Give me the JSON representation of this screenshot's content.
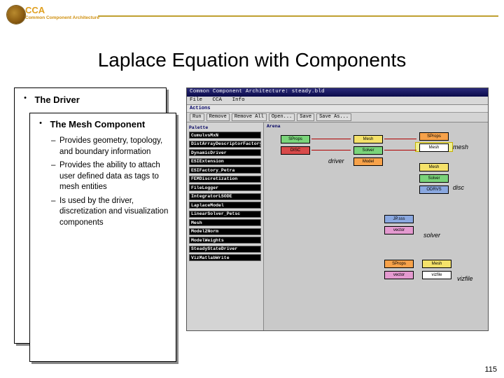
{
  "brand": {
    "abbr": "CCA",
    "full": "Common Component Architecture"
  },
  "title": "Laplace Equation with Components",
  "driver": {
    "label": "The Driver"
  },
  "mesh": {
    "title": "The Mesh Component",
    "items": [
      "Provides geometry, topology, and boundary information",
      "Provides the ability to attach user defined data as tags to mesh entities",
      "Is used by the driver, discretization and visualization components"
    ]
  },
  "screenshot": {
    "window_title": "Common Component Architecture: steady.bld",
    "menubar": {
      "file": "File",
      "cca": "CCA",
      "info": "Info"
    },
    "actions_label": "Actions",
    "toolbar": [
      "Run",
      "Remove",
      "Remove All",
      "Open...",
      "Save",
      "Save As..."
    ],
    "palette_header": "Palette",
    "palette": [
      "CumulvsMxN",
      "DistArrayDescriptorFactory",
      "DynamicDriver",
      "ESIExtension",
      "ESIFactory_Petra",
      "FEMDiscretization",
      "FileLogger",
      "IntegratorLSODE",
      "LaplaceModel",
      "LinearSolver_Petsc",
      "Mesh",
      "Model2Norm",
      "ModelWeights",
      "SteadyStateDriver",
      "VizMatlabWrite"
    ],
    "arena_header": "Arena",
    "groups": {
      "driver": "driver",
      "mesh": "mesh",
      "disc": "disc",
      "solver": "solver",
      "vizfile": "vizfile"
    },
    "nodes": {
      "sProps": "SProps",
      "mesh": "Mesh",
      "disc": "DISC",
      "solver": "Solver",
      "model": "Model",
      "odrvs": "ODRVS",
      "jpsss": "JP.sss",
      "vector": "vector",
      "vizfile": "vizfile"
    }
  },
  "page_number": "115"
}
